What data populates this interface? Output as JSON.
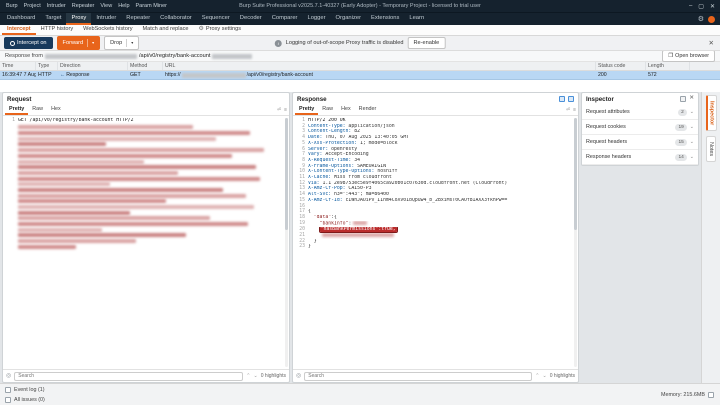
{
  "window": {
    "title": "Burp Suite Professional v2025.7.1-40327 (Early Adopter) - Temporary Project - licensed to trial user",
    "menu": [
      "Burp",
      "Project",
      "Intruder",
      "Repeater",
      "View",
      "Help",
      "Param Miner"
    ]
  },
  "icons": {
    "minimize": "–",
    "maximize": "▢",
    "close": "✕",
    "gear": "⚙",
    "info": "i",
    "caret_down": "▾",
    "chevron_down": "⌄",
    "chevron_up": "⌃",
    "search_target": "◎",
    "wrap": "⏎",
    "lines": "≡",
    "arrow_left": "←",
    "browser": "❐"
  },
  "main_tabs": {
    "items": [
      "Dashboard",
      "Target",
      "Proxy",
      "Intruder",
      "Repeater",
      "Collaborator",
      "Sequencer",
      "Decoder",
      "Comparer",
      "Logger",
      "Organizer",
      "Extensions",
      "Learn"
    ],
    "active": "Proxy"
  },
  "sub_tabs": {
    "items": [
      {
        "label": "Intercept"
      },
      {
        "label": "HTTP history"
      },
      {
        "label": "WebSockets history"
      },
      {
        "label": "Match and replace"
      },
      {
        "label": "Proxy settings",
        "icon": "gear"
      }
    ],
    "active": "Intercept"
  },
  "toolbar": {
    "intercept_button": "Intercept on",
    "forward_button": "Forward",
    "drop_button": "Drop",
    "banner_text": "Logging of out-of-scope Proxy traffic is disabled",
    "reenable_button": "Re-enable"
  },
  "response_bar": {
    "prefix": "Response from",
    "path": "/api/v0/registry/bank-account",
    "open_browser": "Open browser"
  },
  "table": {
    "columns": [
      "Time",
      "Type",
      "Direction",
      "Method",
      "URL",
      "Status code",
      "Length"
    ],
    "row": {
      "time": "16:39:47 7 Aug 2...",
      "type": "HTTP",
      "direction": "Response",
      "method": "GET",
      "url_scheme": "https://",
      "url_path": "/api/v0/registry/bank-account",
      "status_code": "200",
      "length": "572"
    }
  },
  "request_panel": {
    "title": "Request",
    "tabs": [
      "Pretty",
      "Raw",
      "Hex"
    ],
    "active_tab": "Pretty",
    "line_number": "1",
    "first_line": "GET /api/v0/registry/bank-account HTTP/2",
    "search_placeholder": "Search",
    "highlights_label": "0 highlights"
  },
  "response_panel": {
    "title": "Response",
    "tabs": [
      "Pretty",
      "Raw",
      "Hex",
      "Render"
    ],
    "active_tab": "Pretty",
    "search_placeholder": "Search",
    "highlights_label": "0 highlights",
    "lines": [
      {
        "n": "1",
        "type": "status",
        "text": "HTTP/2 200 OK"
      },
      {
        "n": "2",
        "type": "header",
        "name": "Content-Type",
        "value": "application/json"
      },
      {
        "n": "3",
        "type": "header",
        "name": "Content-Length",
        "value": "82"
      },
      {
        "n": "4",
        "type": "header",
        "name": "Date",
        "value": "Thu, 07 Aug 2025 13:40:05 GMT"
      },
      {
        "n": "5",
        "type": "header",
        "name": "X-Xss-Protection",
        "value": "1; mode=block"
      },
      {
        "n": "6",
        "type": "header",
        "name": "Server",
        "value": "openresty"
      },
      {
        "n": "7",
        "type": "header",
        "name": "Vary",
        "value": "Accept-Encoding"
      },
      {
        "n": "8",
        "type": "header",
        "name": "X-Request-Time",
        "value": "34"
      },
      {
        "n": "9",
        "type": "header",
        "name": "X-Frame-Options",
        "value": "SAMEORIGIN"
      },
      {
        "n": "10",
        "type": "header",
        "name": "X-Content-Type-Options",
        "value": "nosniff"
      },
      {
        "n": "11",
        "type": "header",
        "name": "X-Cache",
        "value": "Miss from cloudfront"
      },
      {
        "n": "12",
        "type": "header",
        "name": "Via",
        "value": "1.1 2e98753ec5e9f4065ca920b01c07630d.cloudfront.net (CloudFront)"
      },
      {
        "n": "13",
        "type": "header",
        "name": "X-Amz-Cf-Pop",
        "value": "CAI50-P3"
      },
      {
        "n": "14",
        "type": "header",
        "name": "Alt-Svc",
        "value": "h3=\":443\"; ma=86400"
      },
      {
        "n": "15",
        "type": "header",
        "name": "X-Amz-Cf-Id",
        "value": "cIWhJAUiPv_IInm4CoXv0IbQpuw4_b_2BxiMsT0CAOf8IAXX3YkhPw=="
      },
      {
        "n": "16",
        "type": "blank"
      },
      {
        "n": "17",
        "type": "json",
        "segs": [
          [
            "p",
            "{"
          ]
        ]
      },
      {
        "n": "18",
        "type": "json",
        "segs": [
          [
            "p",
            "  "
          ],
          [
            "k",
            "\"data\""
          ],
          [
            "p",
            ":{"
          ]
        ]
      },
      {
        "n": "19",
        "type": "json",
        "segs": [
          [
            "p",
            "    "
          ],
          [
            "k",
            "\"bankInfo\""
          ],
          [
            "p",
            ":"
          ],
          [
            "red",
            "14"
          ]
        ]
      },
      {
        "n": "20",
        "type": "json",
        "segs": [
          [
            "p",
            "    "
          ],
          [
            "hl",
            "\"hasBankPermissions\":true,"
          ]
        ]
      },
      {
        "n": "21",
        "type": "json",
        "segs": [
          [
            "p",
            "    "
          ],
          [
            "red",
            "72"
          ]
        ]
      },
      {
        "n": "22",
        "type": "json",
        "segs": [
          [
            "p",
            "  }"
          ]
        ]
      },
      {
        "n": "23",
        "type": "json",
        "segs": [
          [
            "p",
            "}"
          ]
        ]
      }
    ]
  },
  "inspector": {
    "title": "Inspector",
    "sections": [
      {
        "label": "Request attributes",
        "count": "2"
      },
      {
        "label": "Request cookies",
        "count": "19"
      },
      {
        "label": "Request headers",
        "count": "15"
      },
      {
        "label": "Response headers",
        "count": "14"
      }
    ],
    "side_tabs": [
      "Inspector",
      "Notes"
    ],
    "active_side_tab": "Inspector"
  },
  "status_bar": {
    "event_log": "Event log (1)",
    "all_issues": "All issues (0)",
    "memory": "Memory: 215.6MB"
  }
}
